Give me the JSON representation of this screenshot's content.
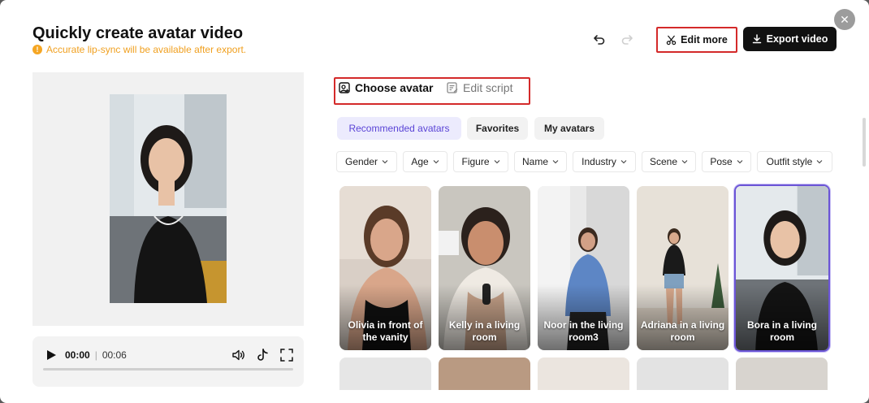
{
  "header": {
    "title": "Quickly create avatar video",
    "notice": "Accurate lip-sync will be available after export.",
    "edit_more_label": "Edit more",
    "export_label": "Export video"
  },
  "player": {
    "current_time": "00:00",
    "separator": "|",
    "duration": "00:06",
    "progress": 0
  },
  "tabs": [
    {
      "label": "Choose avatar",
      "active": true
    },
    {
      "label": "Edit script",
      "active": false
    }
  ],
  "categories": [
    {
      "label": "Recommended avatars",
      "selected": true
    },
    {
      "label": "Favorites",
      "selected": false
    },
    {
      "label": "My avatars",
      "selected": false
    }
  ],
  "filters": [
    {
      "label": "Gender"
    },
    {
      "label": "Age"
    },
    {
      "label": "Figure"
    },
    {
      "label": "Name"
    },
    {
      "label": "Industry"
    },
    {
      "label": "Scene"
    },
    {
      "label": "Pose"
    },
    {
      "label": "Outfit style"
    }
  ],
  "avatars": [
    {
      "label": "Olivia in front of the vanity",
      "selected": false
    },
    {
      "label": "Kelly in a living room",
      "selected": false
    },
    {
      "label": "Noor in the living room3",
      "selected": false
    },
    {
      "label": "Adriana in a living room",
      "selected": false
    },
    {
      "label": "Bora in a living room",
      "selected": true
    }
  ],
  "colors": {
    "accent": "#5a44d6",
    "highlight_box": "#d42a2a",
    "warning": "#f5a623"
  }
}
